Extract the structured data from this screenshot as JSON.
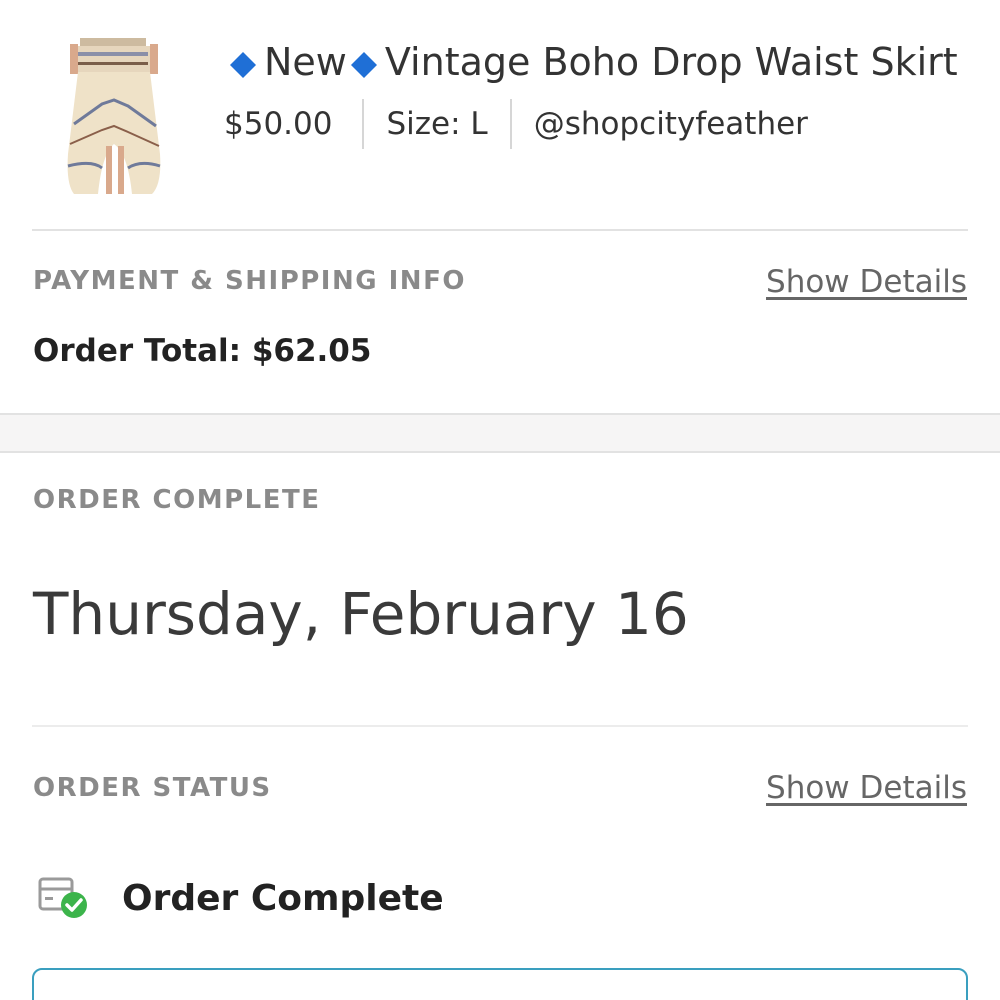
{
  "product": {
    "title_new": "New",
    "title_name": "Vintage Boho Drop Waist Skirt",
    "price": "$50.00",
    "size": "Size: L",
    "seller": "@shopcityfeather",
    "image_icon": "skirt-photo"
  },
  "payment": {
    "section_label": "PAYMENT & SHIPPING INFO",
    "details_link": "Show Details",
    "order_total": "Order Total: $62.05"
  },
  "order_complete": {
    "section_label": "ORDER COMPLETE",
    "date": "Thursday, February 16"
  },
  "order_status": {
    "section_label": "ORDER STATUS",
    "details_link": "Show Details",
    "status_text": "Order Complete",
    "status_icon": "package-check-icon"
  },
  "colors": {
    "diamond": "#1f6fd6",
    "check": "#3cb44b",
    "box_border": "#3a9fbf"
  }
}
